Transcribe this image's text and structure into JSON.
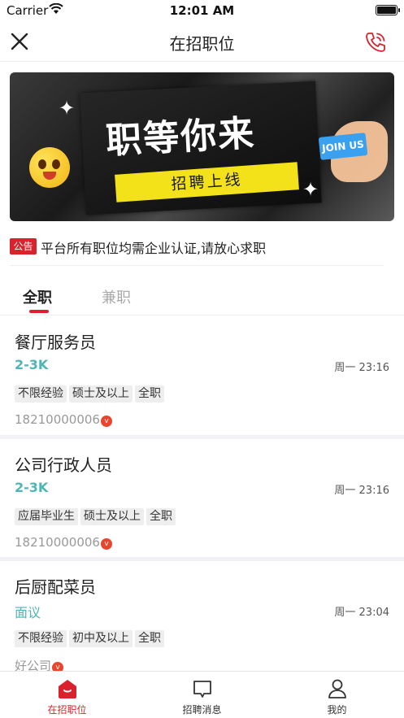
{
  "status_bar": {
    "carrier": "Carrier",
    "time": "12:01 AM"
  },
  "nav": {
    "title": "在招职位"
  },
  "banner": {
    "headline": "职等你来",
    "subline": "招聘上线",
    "badge": "JOIN US"
  },
  "notice": {
    "tag": "公告",
    "text": "平台所有职位均需企业认证,请放心求职"
  },
  "tabs": [
    {
      "label": "全职",
      "active": true
    },
    {
      "label": "兼职",
      "active": false
    }
  ],
  "jobs": [
    {
      "title": "餐厅服务员",
      "salary": "2-3K",
      "date": "周一 23:16",
      "tags": [
        "不限经验",
        "硕士及以上",
        "全职"
      ],
      "company": "18210000006"
    },
    {
      "title": "公司行政人员",
      "salary": "2-3K",
      "date": "周一 23:16",
      "tags": [
        "应届毕业生",
        "硕士及以上",
        "全职"
      ],
      "company": "18210000006"
    },
    {
      "title": "后厨配菜员",
      "salary": "面议",
      "date": "周一 23:04",
      "tags": [
        "不限经验",
        "初中及以上",
        "全职"
      ],
      "company": "好公司"
    }
  ],
  "tab_bar": [
    {
      "label": "在招职位",
      "icon": "home-icon",
      "active": true
    },
    {
      "label": "招聘消息",
      "icon": "message-icon",
      "active": false
    },
    {
      "label": "我的",
      "icon": "person-icon",
      "active": false
    }
  ],
  "colors": {
    "accent_red": "#d9222b",
    "salary_teal": "#4db6b4",
    "banner_yellow": "#f3e21a"
  }
}
